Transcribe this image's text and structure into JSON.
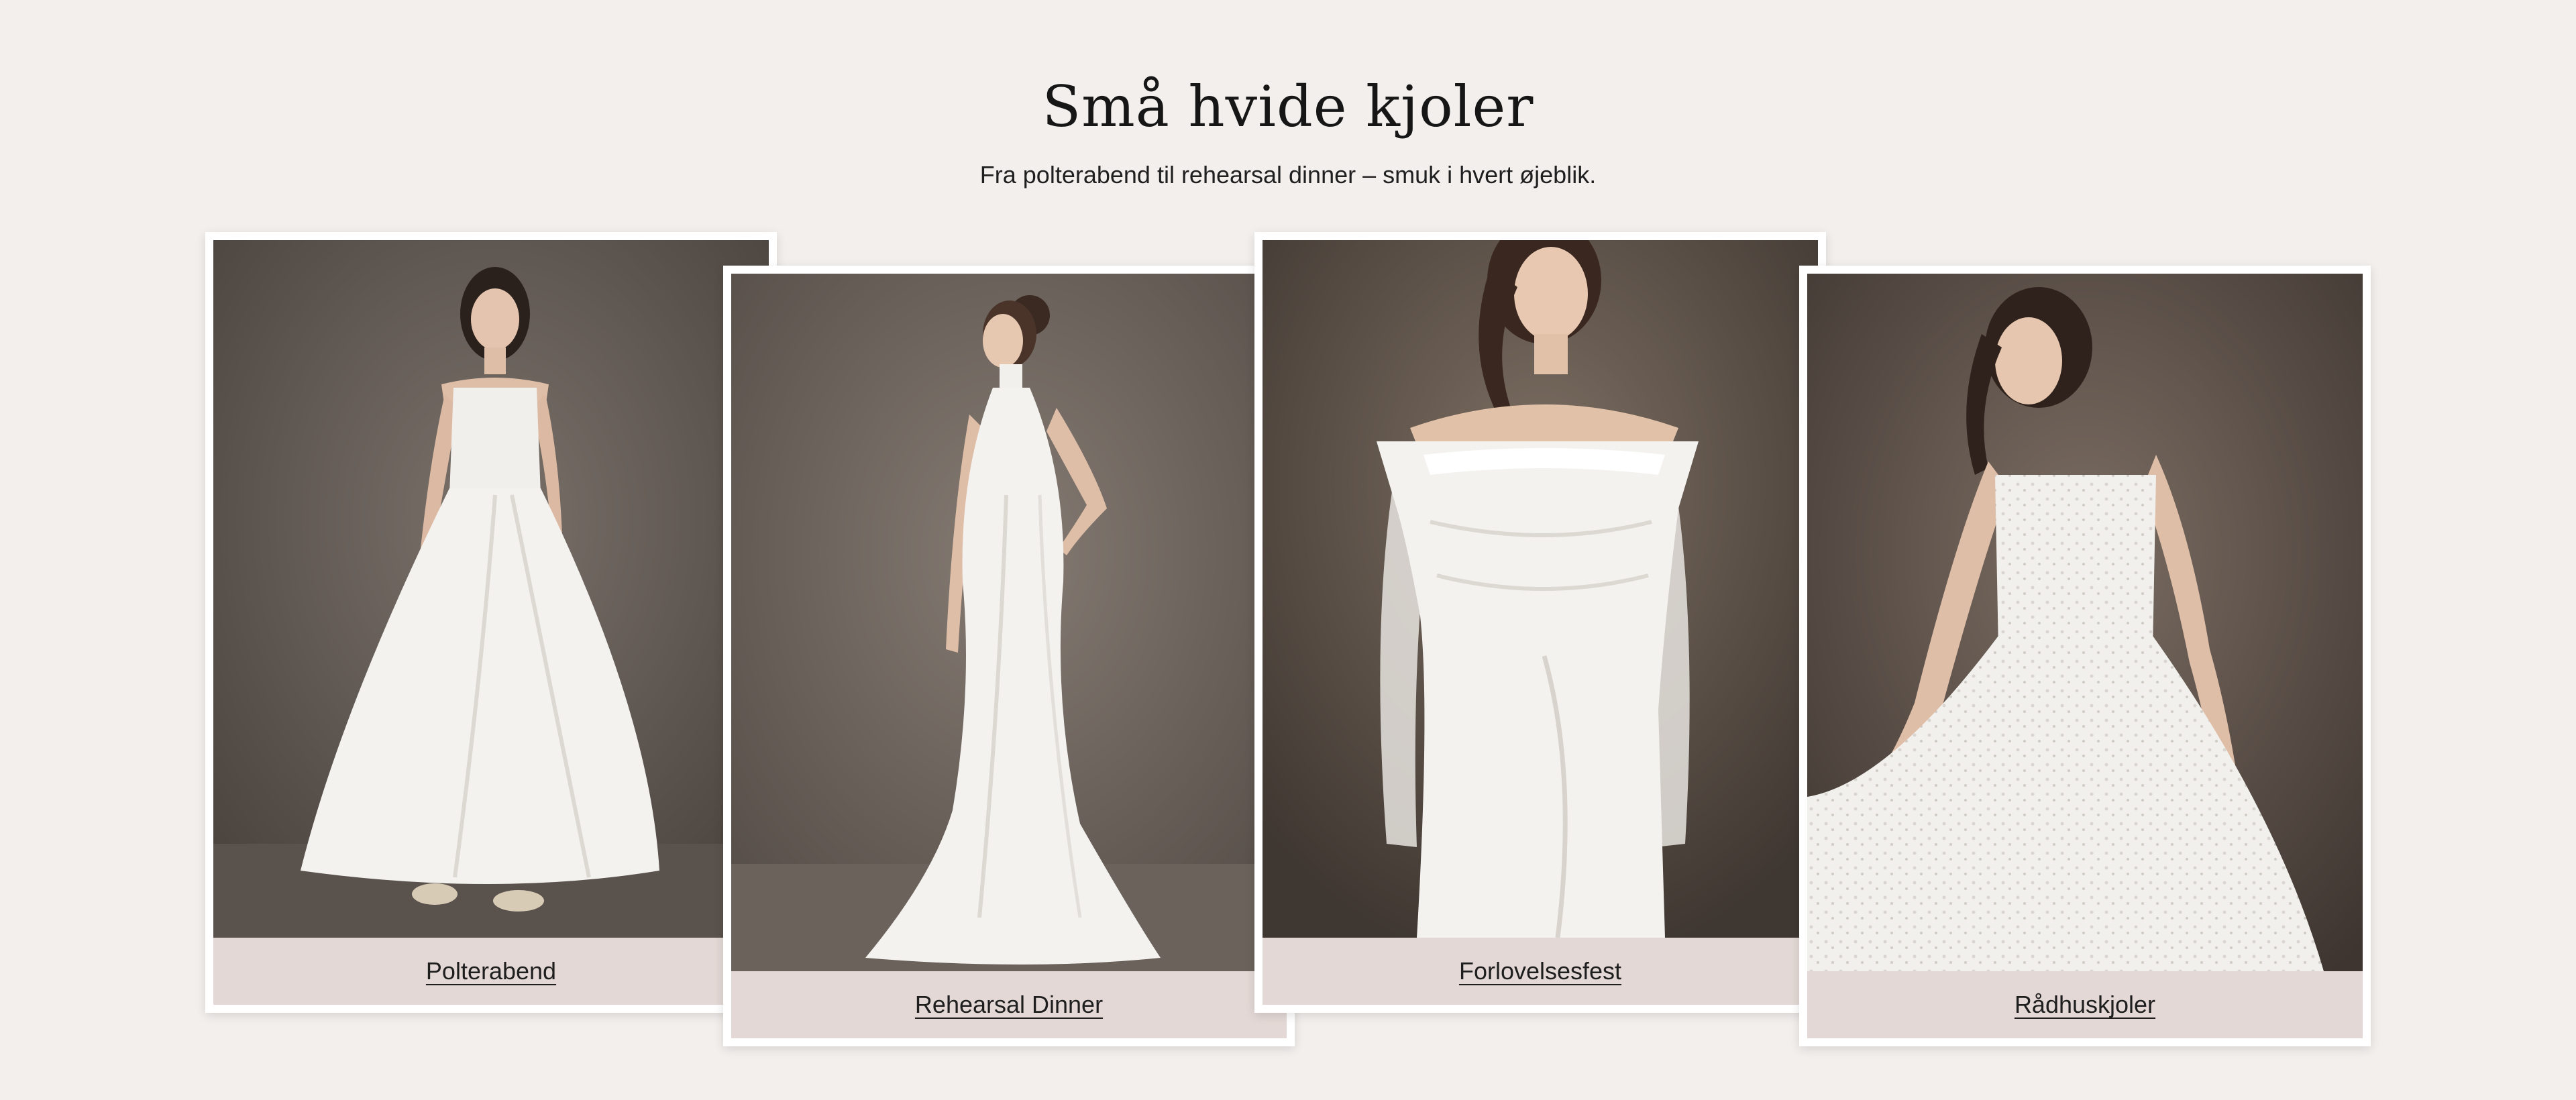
{
  "section": {
    "title": "Små hvide kjoler",
    "subtitle": "Fra polterabend til rehearsal dinner – smuk i hvert øjeblik."
  },
  "cards": [
    {
      "label": "Polterabend",
      "image": "bride-satin-midi-dress-photo"
    },
    {
      "label": "Rehearsal Dinner",
      "image": "bride-halter-mermaid-gown-photo"
    },
    {
      "label": "Forlovelsesfest",
      "image": "bride-off-shoulder-lace-sleeve-dress-photo"
    },
    {
      "label": "Rådhuskjoler",
      "image": "bride-embellished-short-dress-photo"
    }
  ],
  "colors": {
    "background": "#f3efed",
    "caption_bar": "#e3d8d5",
    "card_frame": "#ffffff",
    "photo_backdrop": "#6b625b",
    "dress": "#f4f2ef"
  }
}
